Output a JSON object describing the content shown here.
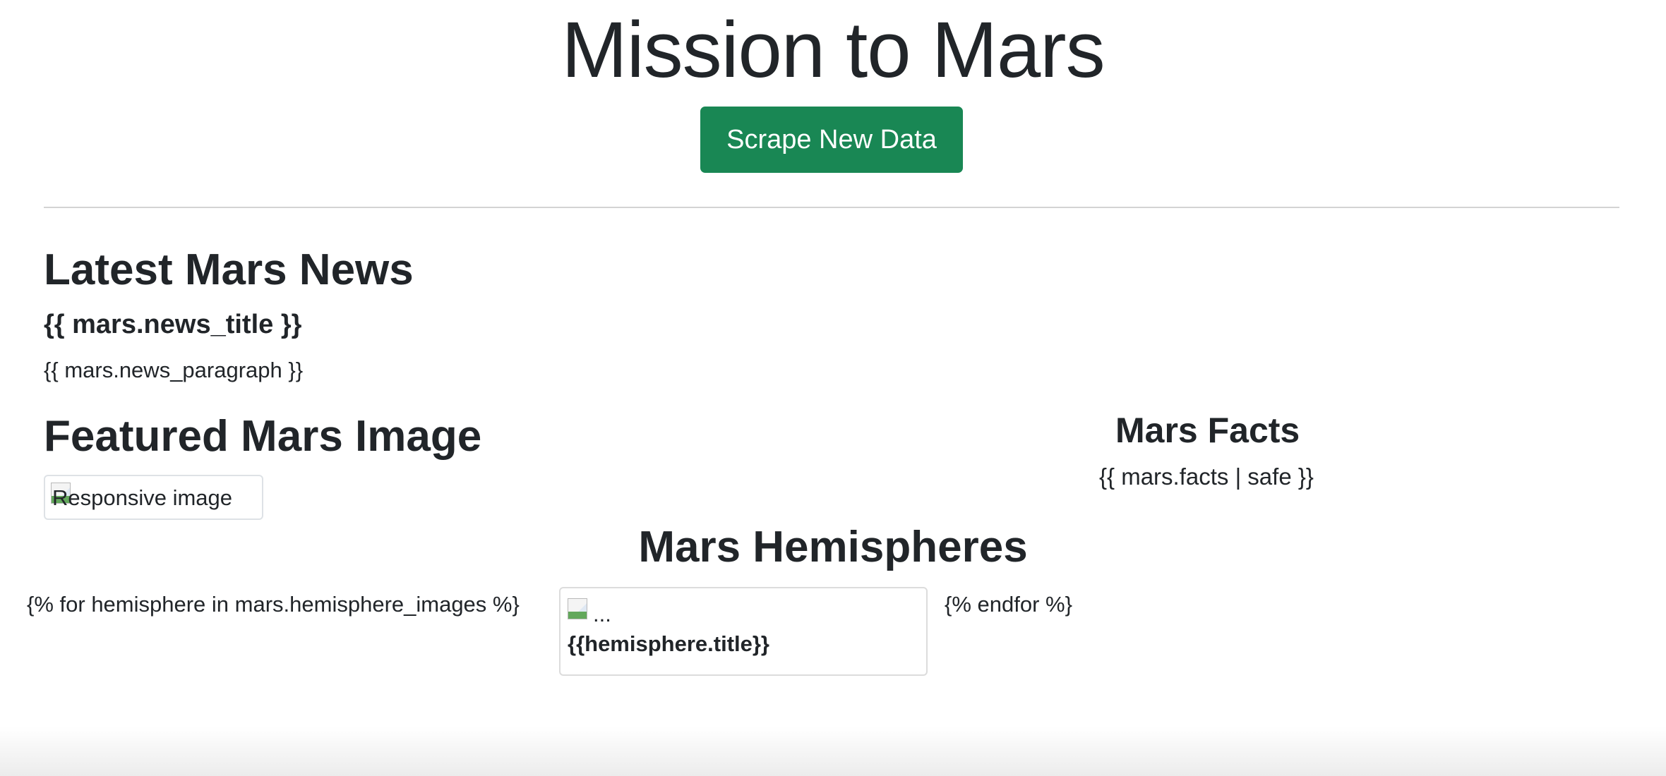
{
  "header": {
    "title": "Mission to Mars",
    "scrape_button_label": "Scrape New Data",
    "button_color": "#198754"
  },
  "news": {
    "heading": "Latest Mars News",
    "title": "{{ mars.news_title }}",
    "paragraph": "{{ mars.news_paragraph }}"
  },
  "featured_image": {
    "heading": "Featured Mars Image",
    "alt_text": "Responsive image",
    "icon": "broken-image-icon"
  },
  "facts": {
    "heading": "Mars Facts",
    "body": "{{ mars.facts | safe }}"
  },
  "hemispheres": {
    "heading": "Mars Hemispheres",
    "loop_open": "{% for hemisphere in mars.hemisphere_images %}",
    "loop_close": "{% endfor %}",
    "card": {
      "image_alt": "...",
      "title": "{{hemisphere.title}}",
      "icon": "broken-image-icon"
    }
  }
}
